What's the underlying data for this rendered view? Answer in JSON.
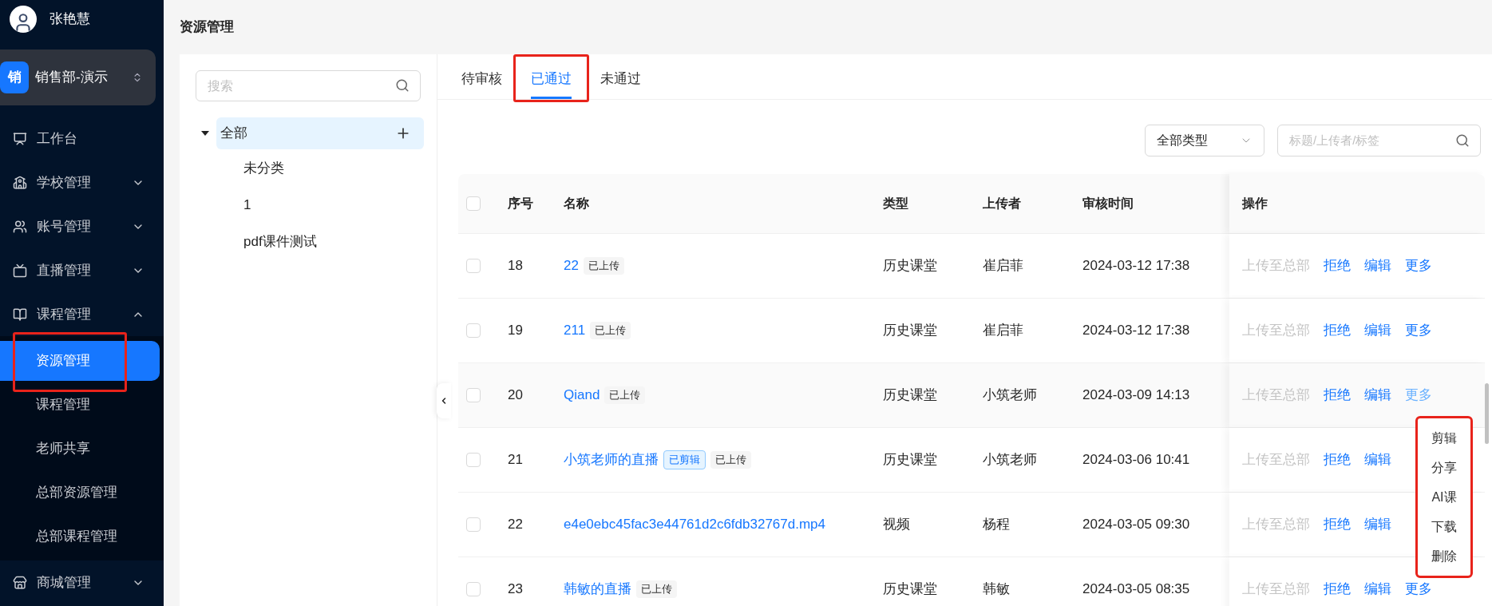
{
  "user": {
    "name": "张艳慧"
  },
  "team": {
    "badge": "销",
    "name": "销售部-演示"
  },
  "nav": [
    {
      "label": "工作台",
      "expandable": false
    },
    {
      "label": "学校管理",
      "expandable": true,
      "expanded": false
    },
    {
      "label": "账号管理",
      "expandable": true,
      "expanded": false
    },
    {
      "label": "直播管理",
      "expandable": true,
      "expanded": false
    },
    {
      "label": "课程管理",
      "expandable": true,
      "expanded": true,
      "children": [
        {
          "label": "资源管理",
          "selected": true,
          "highlighted": true
        },
        {
          "label": "课程管理",
          "selected": false,
          "highlighted": false
        },
        {
          "label": "老师共享",
          "selected": false,
          "highlighted": false
        },
        {
          "label": "总部资源管理",
          "selected": false,
          "highlighted": false
        },
        {
          "label": "总部课程管理",
          "selected": false,
          "highlighted": false
        }
      ]
    },
    {
      "label": "商城管理",
      "expandable": true,
      "expanded": false
    }
  ],
  "page_title": "资源管理",
  "tree": {
    "search": {
      "placeholder": "搜索"
    },
    "nodes": [
      {
        "label": "全部",
        "selected": true,
        "expanded": true,
        "children": [
          {
            "label": "未分类",
            "selected": false
          },
          {
            "label": "1",
            "selected": false
          },
          {
            "label": "pdf课件测试",
            "selected": false
          }
        ]
      }
    ]
  },
  "tabs": [
    {
      "label": "待审核",
      "selected": false,
      "highlighted": false
    },
    {
      "label": "已通过",
      "selected": true,
      "highlighted": true
    },
    {
      "label": "未通过",
      "selected": false,
      "highlighted": false
    }
  ],
  "filters": {
    "type_select": {
      "value": "全部类型"
    },
    "search": {
      "placeholder": "标题/上传者/标签"
    }
  },
  "table": {
    "all_checked": false,
    "columns": [
      "序号",
      "名称",
      "类型",
      "上传者",
      "审核时间",
      "操作"
    ],
    "rows": [
      {
        "index": "18",
        "name": "22",
        "tags": [
          {
            "label": "已上传",
            "kind": "plain"
          }
        ],
        "type": "历史课堂",
        "uploader": "崔启菲",
        "time": "2024-03-12 17:38",
        "checked": false,
        "hovered": false,
        "actions": [
          {
            "label": "上传至总部",
            "disabled": true
          },
          {
            "label": "拒绝",
            "disabled": false
          },
          {
            "label": "编辑",
            "disabled": false
          },
          {
            "label": "更多",
            "disabled": false
          }
        ]
      },
      {
        "index": "19",
        "name": "211",
        "tags": [
          {
            "label": "已上传",
            "kind": "plain"
          }
        ],
        "type": "历史课堂",
        "uploader": "崔启菲",
        "time": "2024-03-12 17:38",
        "checked": false,
        "hovered": false,
        "actions": [
          {
            "label": "上传至总部",
            "disabled": true
          },
          {
            "label": "拒绝",
            "disabled": false
          },
          {
            "label": "编辑",
            "disabled": false
          },
          {
            "label": "更多",
            "disabled": false
          }
        ]
      },
      {
        "index": "20",
        "name": "Qiand",
        "tags": [
          {
            "label": "已上传",
            "kind": "plain"
          }
        ],
        "type": "历史课堂",
        "uploader": "小筑老师",
        "time": "2024-03-09 14:13",
        "checked": false,
        "hovered": true,
        "actions": [
          {
            "label": "上传至总部",
            "disabled": true
          },
          {
            "label": "拒绝",
            "disabled": false
          },
          {
            "label": "编辑",
            "disabled": false
          },
          {
            "label": "更多",
            "disabled": false
          }
        ]
      },
      {
        "index": "21",
        "name": "小筑老师的直播",
        "tags": [
          {
            "label": "已剪辑",
            "kind": "blue"
          },
          {
            "label": "已上传",
            "kind": "plain"
          }
        ],
        "type": "历史课堂",
        "uploader": "小筑老师",
        "time": "2024-03-06 10:41",
        "checked": false,
        "hovered": false,
        "actions": [
          {
            "label": "上传至总部",
            "disabled": true
          },
          {
            "label": "拒绝",
            "disabled": false
          },
          {
            "label": "编辑",
            "disabled": false
          }
        ]
      },
      {
        "index": "22",
        "name": "e4e0ebc45fac3e44761d2c6fdb32767d.mp4",
        "tags": [],
        "type": "视频",
        "uploader": "杨程",
        "time": "2024-03-05 09:30",
        "checked": false,
        "hovered": false,
        "actions": [
          {
            "label": "上传至总部",
            "disabled": true
          },
          {
            "label": "拒绝",
            "disabled": false
          },
          {
            "label": "编辑",
            "disabled": false
          }
        ]
      },
      {
        "index": "23",
        "name": "韩敏的直播",
        "tags": [
          {
            "label": "已上传",
            "kind": "plain"
          }
        ],
        "type": "历史课堂",
        "uploader": "韩敏",
        "time": "2024-03-05 08:35",
        "checked": false,
        "hovered": false,
        "actions": [
          {
            "label": "上传至总部",
            "disabled": true
          },
          {
            "label": "拒绝",
            "disabled": false
          },
          {
            "label": "编辑",
            "disabled": false
          },
          {
            "label": "更多",
            "disabled": false
          }
        ]
      }
    ]
  },
  "more_menu": {
    "highlighted": true,
    "items": [
      "剪辑",
      "分享",
      "AI课",
      "下载",
      "删除"
    ]
  }
}
